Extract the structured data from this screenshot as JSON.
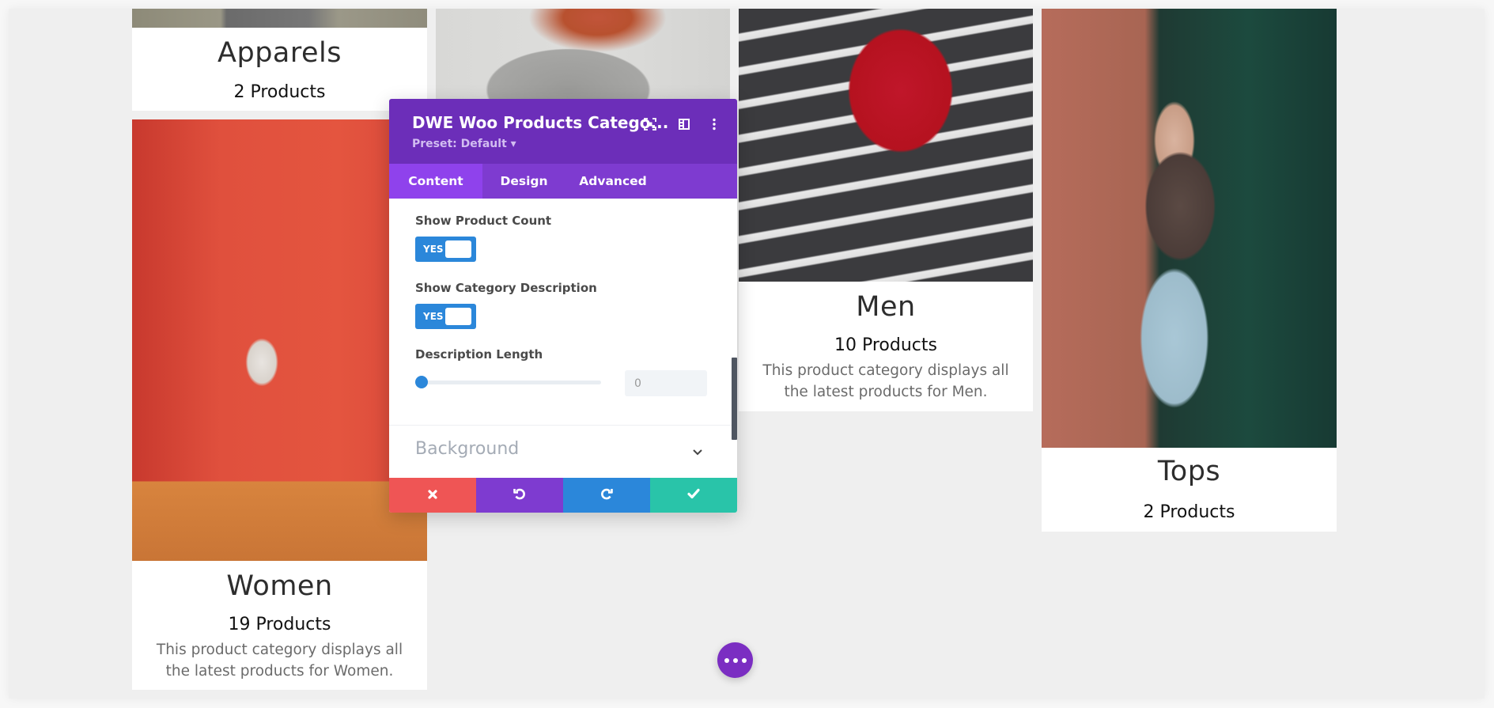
{
  "categories": [
    {
      "name": "Apparels",
      "count": "2 Products",
      "description": ""
    },
    {
      "name": "Women",
      "count": "19 Products",
      "description": "This product category displays all the latest products for Women."
    },
    {
      "name": "Men",
      "count": "10 Products",
      "description": "This product category displays all the latest products for Men."
    },
    {
      "name": "Tops",
      "count": "2 Products",
      "description": ""
    }
  ],
  "panel": {
    "title": "DWE Woo Products Catego...",
    "preset": "Preset: Default ▾",
    "header_icons": [
      "fullscreen-icon",
      "sidebar-layout-icon",
      "more-options-icon"
    ],
    "tabs": [
      {
        "label": "Content",
        "active": true
      },
      {
        "label": "Design",
        "active": false
      },
      {
        "label": "Advanced",
        "active": false
      }
    ],
    "fields": {
      "show_product_count": {
        "label": "Show Product Count",
        "value": "YES"
      },
      "show_category_description": {
        "label": "Show Category Description",
        "value": "YES"
      },
      "description_length": {
        "label": "Description Length",
        "value": "0",
        "slider_percent": 0
      }
    },
    "section": {
      "label": "Background"
    },
    "footer": {
      "cancel": {
        "icon": "close-icon",
        "color": "#ef5555"
      },
      "undo": {
        "icon": "undo-icon",
        "color": "#7e3bd0"
      },
      "redo": {
        "icon": "redo-icon",
        "color": "#2b87da"
      },
      "save": {
        "icon": "check-icon",
        "color": "#29c4a9"
      }
    }
  },
  "colors": {
    "header": "#6c2eb9",
    "tabs": "#7e3bd0",
    "tab_active": "#8f42ec",
    "toggle": "#2b87da",
    "fab": "#7b2ec2"
  }
}
